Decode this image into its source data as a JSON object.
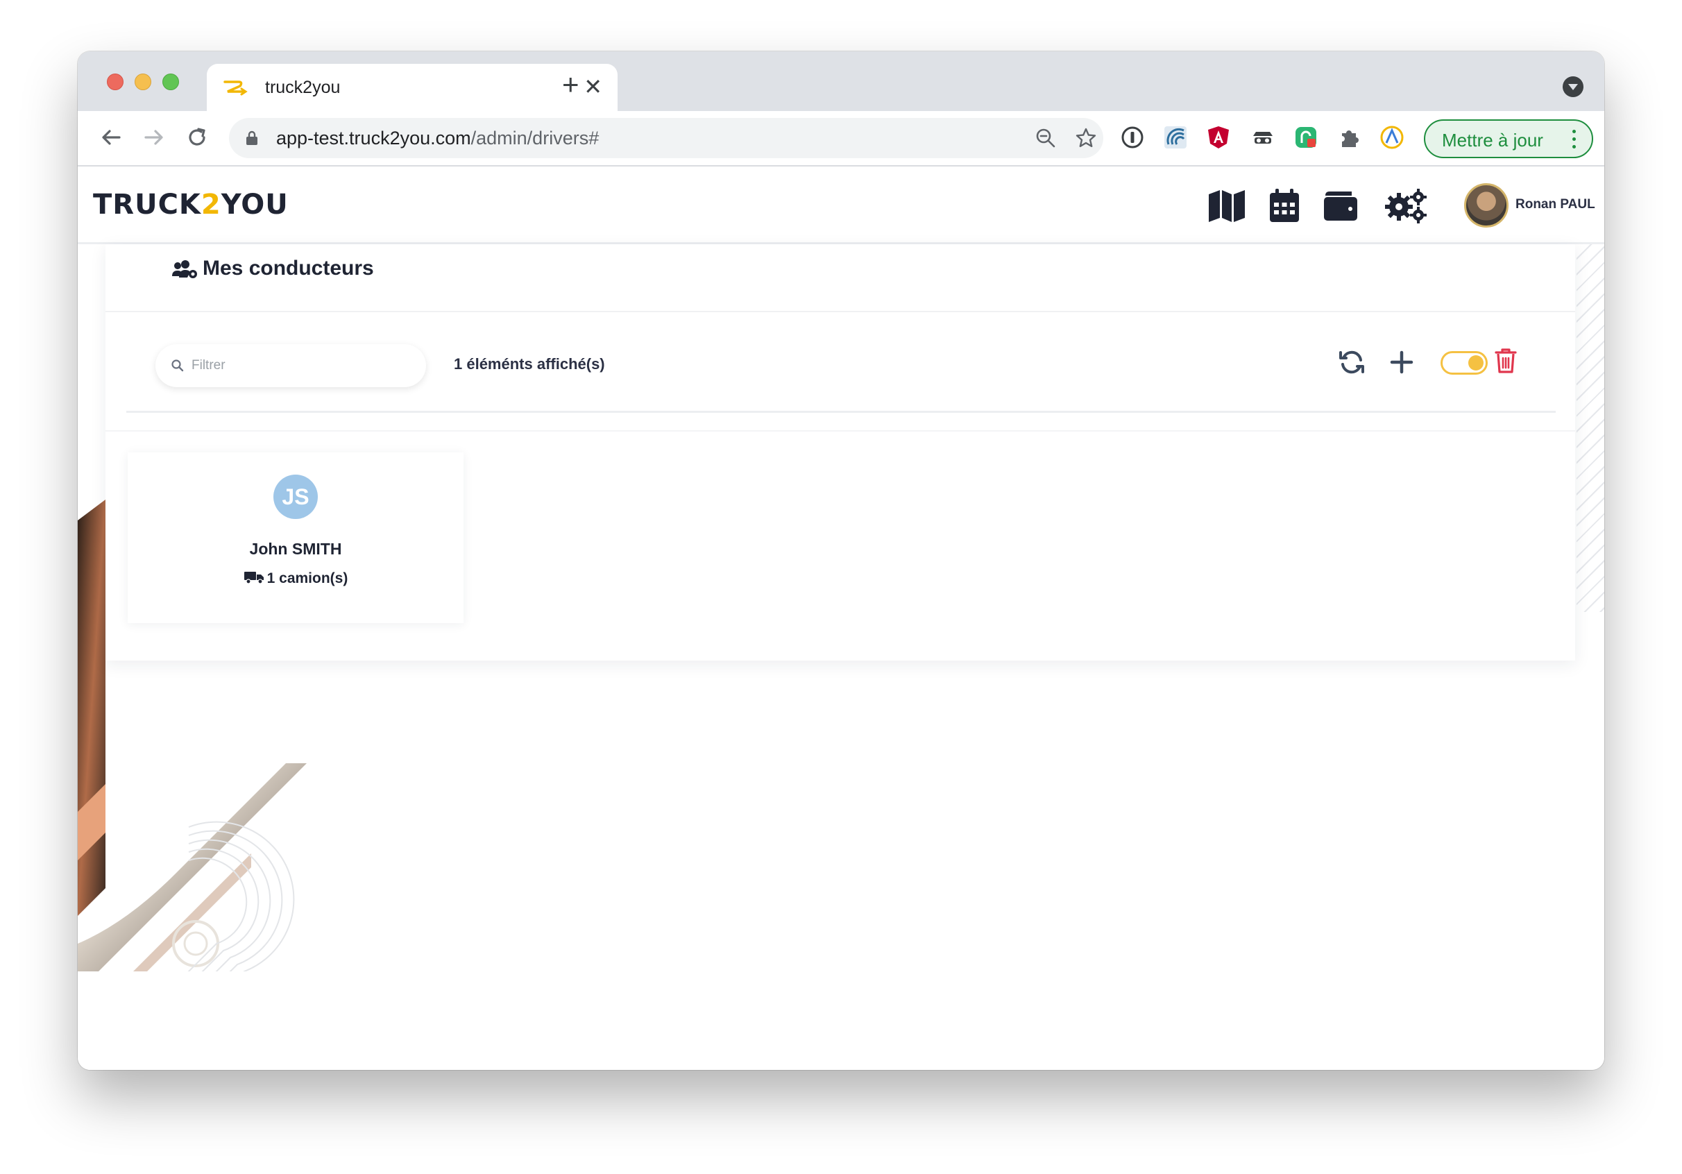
{
  "browser": {
    "tab_title": "truck2you",
    "url_host": "app-test.truck2you.com",
    "url_path": "/admin/drivers#",
    "update_button": "Mettre à jour"
  },
  "app": {
    "logo": {
      "part1": "TRUCK",
      "part2": "2",
      "part3": "YOU"
    },
    "header_icons": [
      "map-icon",
      "calendar-icon",
      "wallet-icon",
      "settings-icon"
    ],
    "user_name": "Ronan PAUL",
    "accent_color": "#f2b705"
  },
  "page": {
    "title": "Mes conducteurs",
    "filter_placeholder": "Filtrer",
    "count_text": "1 éléménts affiché(s)",
    "toggle_on": true
  },
  "drivers": [
    {
      "initials": "JS",
      "name": "John SMITH",
      "trucks": "1 camion(s)"
    }
  ]
}
